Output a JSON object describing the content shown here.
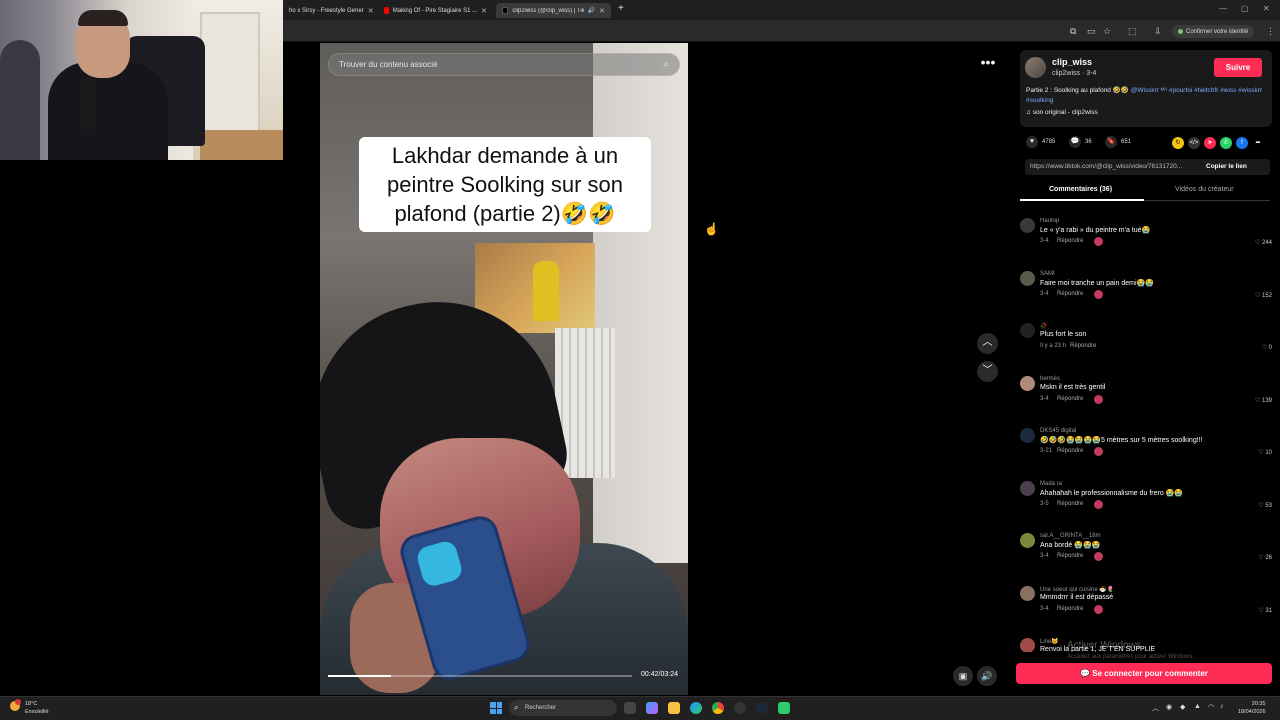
{
  "browser": {
    "tabs": [
      {
        "title": "ho x Sirsy - Freestyle Gener"
      },
      {
        "title": "Making Of - Pire Stagiaire S1 ..."
      },
      {
        "title": "clip2wiss (@clip_wiss) | TikTok"
      }
    ],
    "new_tab": "+",
    "verify_label": "Confirmer votre identité"
  },
  "player": {
    "search_placeholder": "Trouver du contenu associé",
    "caption": "Lakhdar demande à un peintre Soolking sur son plafond (partie 2)🤣🤣",
    "timecode": "00:42/03:24",
    "progress": 0.207
  },
  "video_info": {
    "author_name": "clip_wiss",
    "author_sub": "clip2wiss · 3-4",
    "follow_label": "Suivre",
    "description_plain": "Partie 2 : Soolking au plafond 🤣🤣 ",
    "description_links": "@Wisskrr ᴹᴬ #pourtoi #twitchfr #wiss #wisskrr #soolking",
    "sound": "son original - clip2wiss",
    "likes": "4785",
    "comments_count": "36",
    "saves": "651",
    "link": "https://www.tiktok.com/@clip_wiss/video/76131720...",
    "copy_label": "Copier le lien",
    "tab_comments": "Commentaires (36)",
    "tab_videos": "Vidéos du créateur"
  },
  "comments": [
    {
      "user": "Hautop",
      "text": "Le « y'a rabi » du peintre m'a tué😭",
      "meta": "3-4",
      "reply": "Répondre",
      "likes": "244",
      "avatar_color": "#3a3a3a"
    },
    {
      "user": "SAMI",
      "text": "Faire moi tranche un pain demi😭😭",
      "meta": "3-4",
      "reply": "Répondre",
      "likes": "152",
      "avatar_color": "#5a5a4a"
    },
    {
      "user": "🥀",
      "text": "Plus fort le son",
      "meta": "Il y a 23 h",
      "reply": "Répondre",
      "likes": "0",
      "avatar_color": "#222"
    },
    {
      "user": "hermès",
      "text": "Mskn il est très gentil",
      "meta": "3-4",
      "reply": "Répondre",
      "likes": "139",
      "avatar_color": "#b08a7a"
    },
    {
      "user": "DKS45 digital",
      "text": "🤣🤣🤣😭😭😭😭5 mètres sur 5 mètres soolking!!!",
      "meta": "3-21",
      "reply": "Répondre",
      "likes": "10",
      "avatar_color": "#1b2b3b"
    },
    {
      "user": "Mada ra",
      "text": "Ahahahah le professionnalisme du frero 😭😭",
      "meta": "3-5",
      "reply": "Répondre",
      "likes": "53",
      "avatar_color": "#4a4050"
    },
    {
      "user": "sal.A__GRINTA__18m",
      "text": "Ana bordé 😭😭😭",
      "meta": "3-4",
      "reply": "Répondre",
      "likes": "26",
      "avatar_color": "#7a8a3a"
    },
    {
      "user": "Une soeur qui cuisine 🍜🌷",
      "text": "Mmmdrrr il est dépassé",
      "meta": "3-4",
      "reply": "Répondre",
      "likes": "31",
      "avatar_color": "#8a7060"
    },
    {
      "user": "Line🐱",
      "text": "Renvoi la partie 1, JE T'EN SUPPLIE",
      "meta": "",
      "reply": "",
      "likes": "",
      "avatar_color": "#a04a4a"
    }
  ],
  "watermark": {
    "title": "Activer Windows",
    "sub": "Accédez aux paramètres pour activer Windows."
  },
  "login_label": "Se connecter pour commenter",
  "taskbar": {
    "temp": "18°C",
    "weather": "Ensoleillé",
    "search_label": "Rechercher",
    "time": "20:35",
    "date": "18/04/2026"
  }
}
